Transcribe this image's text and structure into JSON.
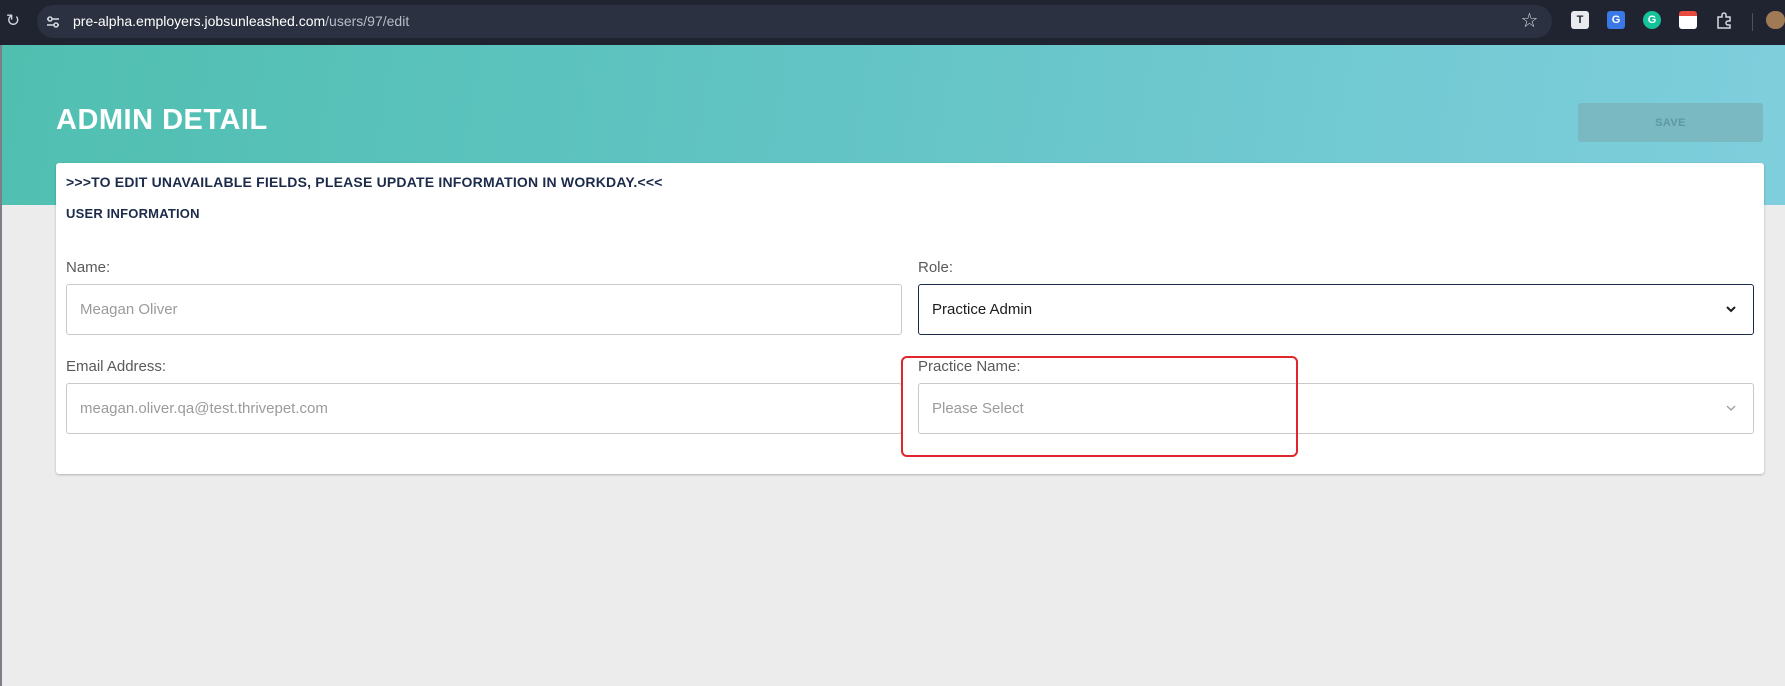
{
  "browser": {
    "url_domain": "pre-alpha.employers.jobsunleashed.com",
    "url_path": "/users/97/edit"
  },
  "page": {
    "title": "ADMIN DETAIL",
    "save_label": "SAVE"
  },
  "card": {
    "notice": ">>>TO EDIT UNAVAILABLE FIELDS, PLEASE UPDATE INFORMATION IN WORKDAY.<<<",
    "section_title": "USER INFORMATION"
  },
  "form": {
    "name_label": "Name:",
    "name_value": "Meagan Oliver",
    "role_label": "Role:",
    "role_value": "Practice Admin",
    "email_label": "Email Address:",
    "email_value": "meagan.oliver.qa@test.thrivepet.com",
    "practice_label": "Practice Name:",
    "practice_placeholder": "Please Select"
  },
  "colors": {
    "header_gradient_start": "#50bfb0",
    "header_gradient_end": "#7fcedd",
    "text_navy": "#1c2b4a",
    "highlight_red": "#e0262b"
  }
}
